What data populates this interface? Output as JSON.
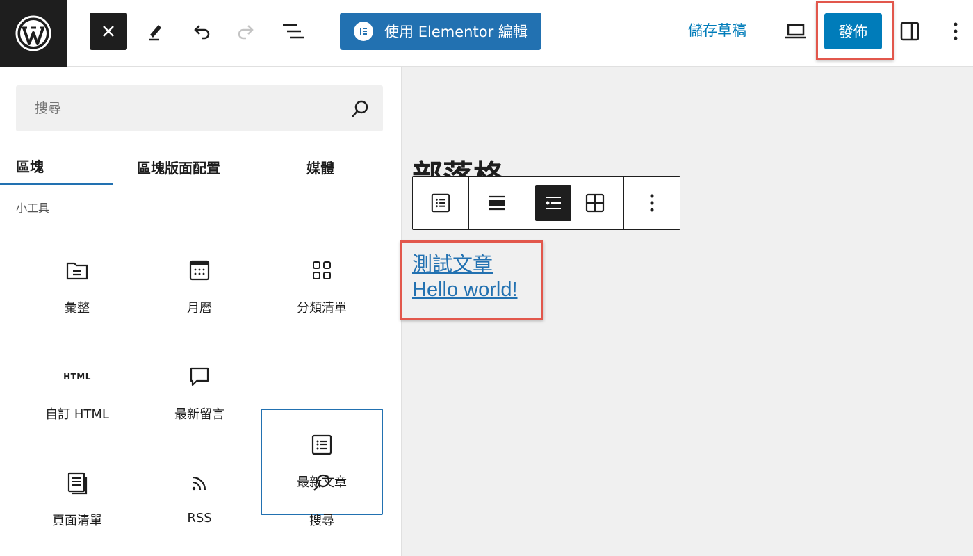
{
  "header": {
    "elementor_label": "使用 Elementor 編輯",
    "save_draft_label": "儲存草稿",
    "publish_label": "發佈"
  },
  "inserter": {
    "search_placeholder": "搜尋",
    "tabs": [
      {
        "label": "區塊",
        "active": true
      },
      {
        "label": "區塊版面配置",
        "active": false
      },
      {
        "label": "媒體",
        "active": false
      }
    ],
    "category_label": "小工具",
    "blocks": [
      {
        "label": "彙整",
        "icon": "archive-folder-icon"
      },
      {
        "label": "月曆",
        "icon": "calendar-icon"
      },
      {
        "label": "分類清單",
        "icon": "categories-grid-icon"
      },
      {
        "label": "自訂 HTML",
        "icon": "html-icon",
        "icon_text": "HTML"
      },
      {
        "label": "最新留言",
        "icon": "comment-icon"
      },
      {
        "label": "最新文章",
        "icon": "post-list-icon",
        "selected": true
      },
      {
        "label": "頁面清單",
        "icon": "page-list-icon"
      },
      {
        "label": "RSS",
        "icon": "rss-icon"
      },
      {
        "label": "搜尋",
        "icon": "search-icon"
      }
    ]
  },
  "canvas": {
    "heading": "部落格",
    "posts": [
      "測試文章",
      "Hello world!"
    ]
  },
  "colors": {
    "accent": "#2271b1",
    "publish": "#007cba",
    "highlight": "#e2574c",
    "dark": "#1e1e1e"
  }
}
